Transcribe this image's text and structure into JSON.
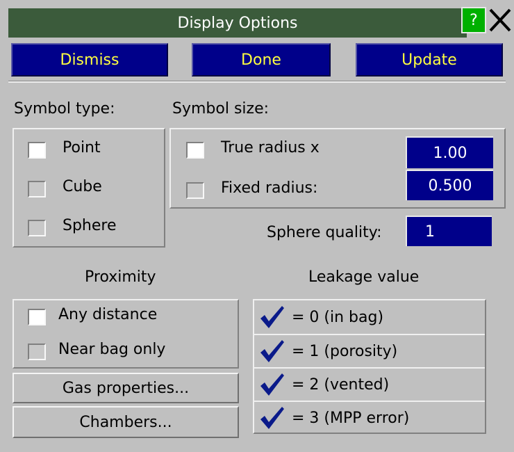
{
  "window": {
    "title": "Display Options",
    "help_label": "?",
    "close_icon": "close-icon"
  },
  "actions": {
    "dismiss": "Dismiss",
    "done": "Done",
    "update": "Update"
  },
  "symbol_type": {
    "heading": "Symbol type:",
    "options": [
      {
        "label": "Point",
        "checked": true
      },
      {
        "label": "Cube",
        "checked": false
      },
      {
        "label": "Sphere",
        "checked": false
      }
    ]
  },
  "symbol_size": {
    "heading": "Symbol size:",
    "options": [
      {
        "label": "True radius x",
        "checked": true,
        "value": "1.00"
      },
      {
        "label": "Fixed radius:",
        "checked": false,
        "value": "0.500"
      }
    ],
    "sphere_quality_label": "Sphere quality:",
    "sphere_quality_value": "1"
  },
  "proximity": {
    "heading": "Proximity",
    "options": [
      {
        "label": "Any distance",
        "checked": true
      },
      {
        "label": "Near bag only",
        "checked": false
      }
    ]
  },
  "buttons": {
    "gas_properties": "Gas properties...",
    "chambers": "Chambers..."
  },
  "leakage": {
    "heading": "Leakage value",
    "options": [
      {
        "label": "= 0 (in bag)",
        "checked": true
      },
      {
        "label": "= 1 (porosity)",
        "checked": true
      },
      {
        "label": "= 2 (vented)",
        "checked": true
      },
      {
        "label": "= 3 (MPP error)",
        "checked": true
      }
    ]
  },
  "colors": {
    "title_bar": "#3b5b3b",
    "button_bg": "#00008a",
    "button_text": "#ffff40",
    "panel_bg": "#c0c0c0",
    "help_bg": "#00b000",
    "check_mark": "#0a1a8a"
  }
}
